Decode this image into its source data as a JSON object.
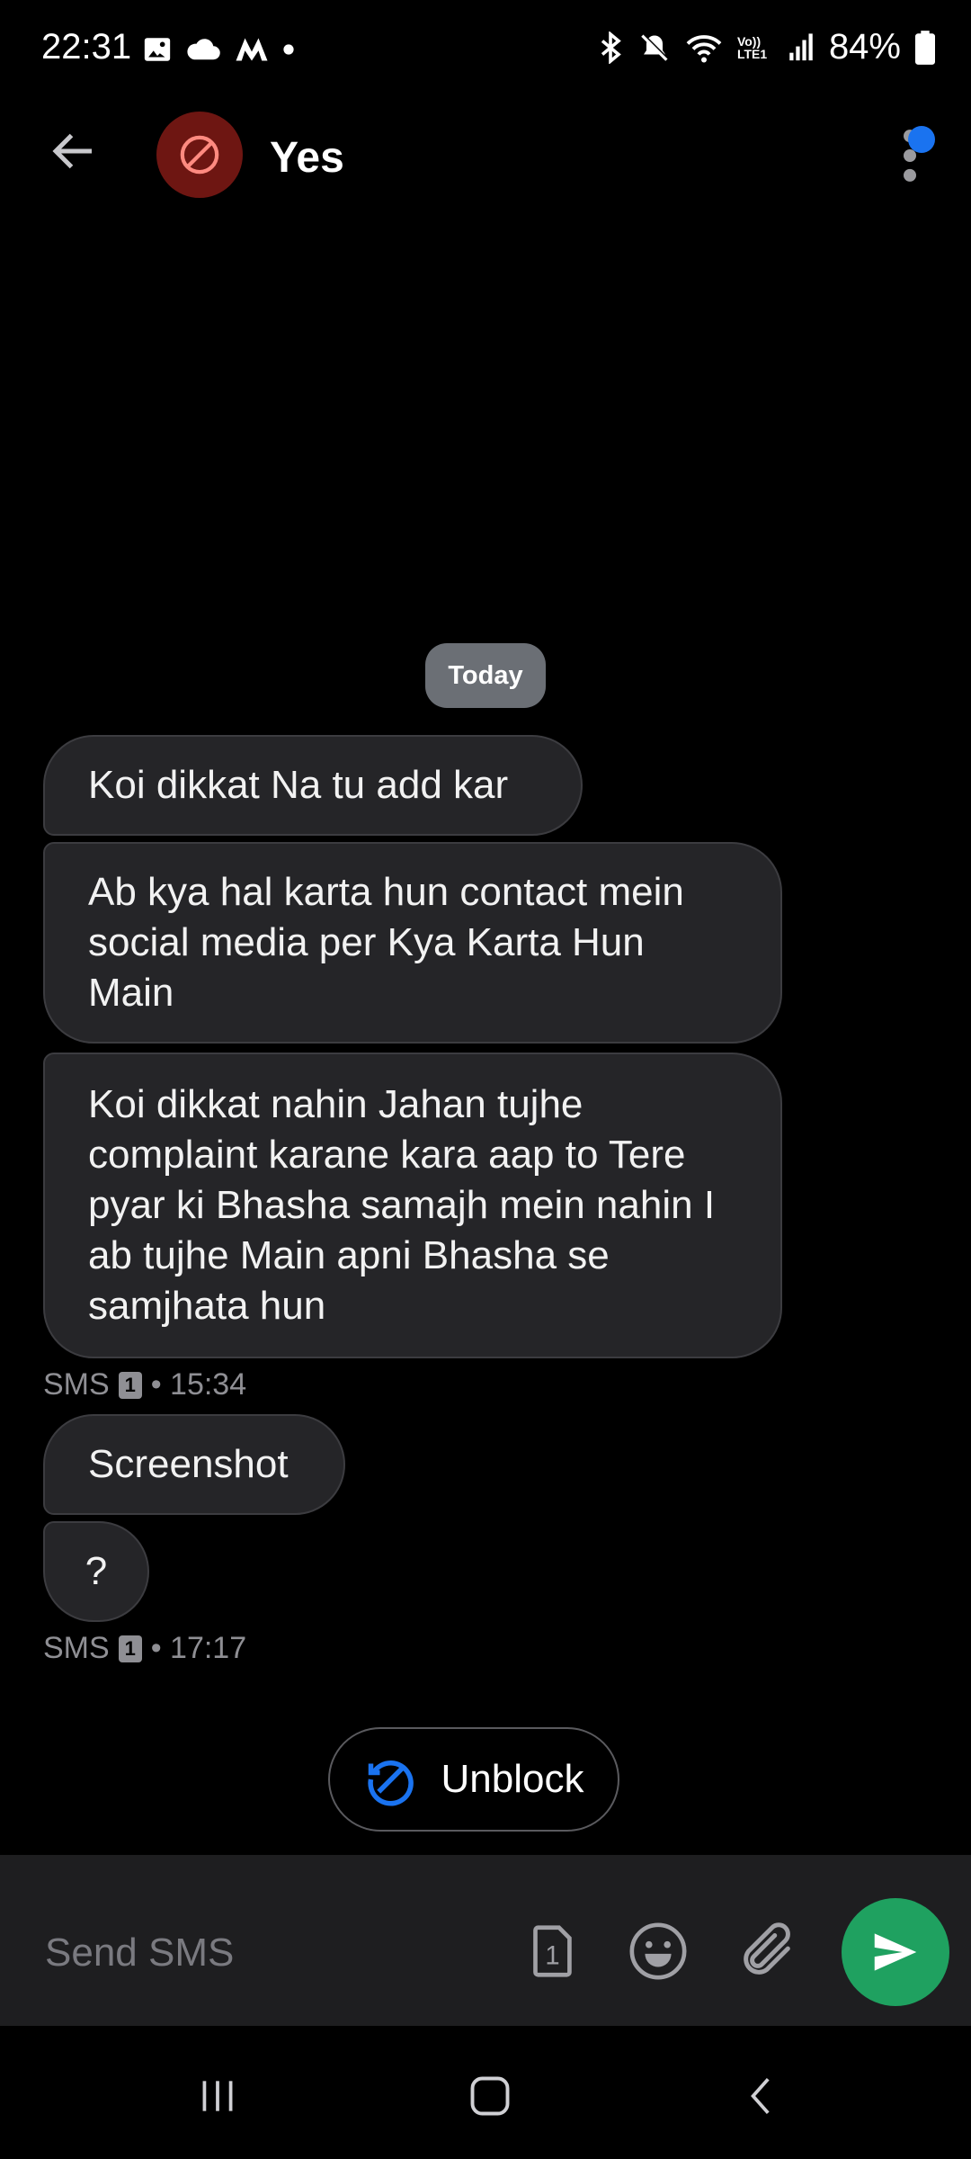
{
  "status_bar": {
    "time": "22:31",
    "battery": "84%",
    "network_label": "Vo)) LTE1"
  },
  "header": {
    "contact_name": "Yes"
  },
  "conversation": {
    "date_chip": "Today",
    "messages": [
      {
        "text": "Koi dikkat Na tu add kar"
      },
      {
        "text": "Ab kya hal karta hun contact mein social media per Kya Karta Hun Main"
      },
      {
        "text": "Koi dikkat nahin Jahan tujhe complaint karane kara aap to Tere pyar ki Bhasha samajh mein nahin I ab tujhe Main apni Bhasha se samjhata hun"
      },
      {
        "text": "Screenshot"
      },
      {
        "text": "?"
      }
    ],
    "meta": [
      {
        "channel": "SMS",
        "sim": "1",
        "time": "• 15:34"
      },
      {
        "channel": "SMS",
        "sim": "1",
        "time": "• 17:17"
      }
    ]
  },
  "unblock": {
    "label": "Unblock"
  },
  "composer": {
    "placeholder": "Send SMS",
    "sim_number": "1"
  },
  "colors": {
    "background": "#000000",
    "bubble": "#252528",
    "avatar_blocked": "#6e1612",
    "send_button": "#1fa160",
    "unblock_icon": "#1a73f0",
    "notification_dot": "#1a73f0"
  },
  "icons": [
    "image-icon",
    "cloud-icon",
    "m-logo-icon",
    "dot-icon",
    "bluetooth-icon",
    "mute-icon",
    "wifi-icon",
    "signal-icon",
    "battery-icon",
    "back-arrow-icon",
    "blocked-icon",
    "more-options-icon",
    "unblock-icon",
    "sim-card-icon",
    "emoji-icon",
    "attach-icon",
    "send-icon",
    "recents-icon",
    "home-icon",
    "nav-back-icon"
  ]
}
